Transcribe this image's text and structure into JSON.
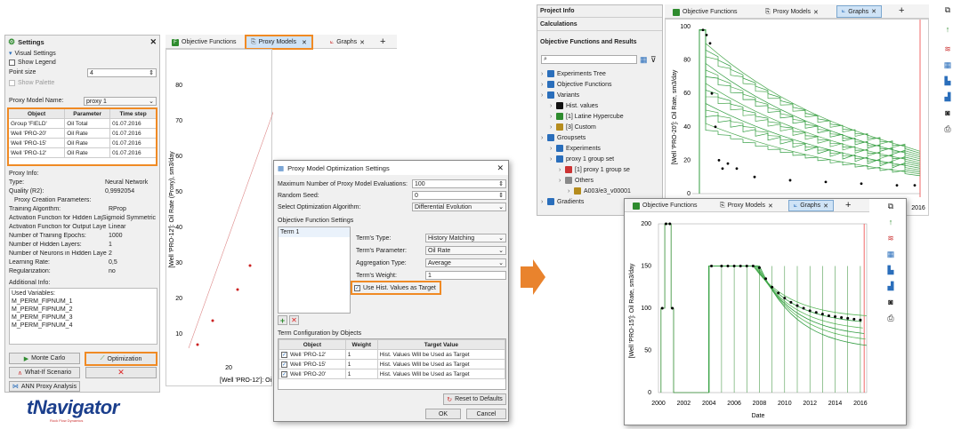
{
  "settings": {
    "title": "Settings",
    "visual_settings": "Visual Settings",
    "show_legend": "Show Legend",
    "point_size_label": "Point size",
    "point_size_value": "4",
    "show_palette": "Show Palette",
    "proxy_model_name_label": "Proxy Model Name:",
    "proxy_model_name_value": "proxy 1",
    "table_headers": [
      "Object",
      "Parameter",
      "Time step"
    ],
    "table_rows": [
      [
        "Group 'FIELD'",
        "Oil Total",
        "01.07.2016"
      ],
      [
        "Well 'PRO-20'",
        "Oil Rate",
        "01.07.2016"
      ],
      [
        "Well 'PRO-15'",
        "Oil Rate",
        "01.07.2016"
      ],
      [
        "Well 'PRO-12'",
        "Oil Rate",
        "01.07.2016"
      ]
    ],
    "proxy_info": "Proxy Info:",
    "type_label": "Type:",
    "type_value": "Neural Network",
    "quality_label": "Quality (R2):",
    "quality_value": "0,9992054",
    "creation_params": "Proxy Creation Parameters:",
    "params": [
      [
        "Training Algorithm:",
        "RProp"
      ],
      [
        "Activation Function for Hidden Laye",
        "Sigmoid Symmetric"
      ],
      [
        "Activation Function for Output Laye",
        "Linear"
      ],
      [
        "Number of Training Epochs:",
        "1000"
      ],
      [
        "Number of Hidden Layers:",
        "1"
      ],
      [
        "Number of Neurons in Hidden Laye",
        "2"
      ],
      [
        "Learning Rate:",
        "0,5"
      ],
      [
        "Regularization:",
        "no"
      ]
    ],
    "additional_info": "Additional Info:",
    "used_variables_label": "Used Variables:",
    "used_variables": [
      "M_PERM_FIPNUM_1",
      "M_PERM_FIPNUM_2",
      "M_PERM_FIPNUM_3",
      "M_PERM_FIPNUM_4"
    ],
    "monte_carlo": "Monte Carlo",
    "optimization": "Optimization",
    "what_if": "What-If Scenario",
    "ann_proxy": "ANN Proxy Analysis"
  },
  "tabs_left": {
    "objective_functions": "Objective Functions",
    "proxy_models": "Proxy Models",
    "graphs": "Graphs",
    "plus": "+"
  },
  "scatter": {
    "y_label": "[Well 'PRO-12']: Oil Rate (Proxy), sm3/day",
    "x_label": "[Well 'PRO-12']: Oi",
    "y_ticks": [
      "80",
      "70",
      "60",
      "50",
      "40",
      "30",
      "20",
      "10"
    ],
    "x_ticks": [
      "20"
    ]
  },
  "dialog": {
    "title": "Proxy Model Optimization Settings",
    "max_evals_label": "Maximum Number of Proxy Model Evaluations:",
    "max_evals_value": "100",
    "random_seed_label": "Random Seed:",
    "random_seed_value": "0",
    "algorithm_label": "Select Optimization Algorithm:",
    "algorithm_value": "Differential Evolution",
    "obj_settings": "Objective Function Settings",
    "term_item": "Term 1",
    "term_type_label": "Term's Type:",
    "term_type_value": "History Matching",
    "term_param_label": "Term's Parameter:",
    "term_param_value": "Oil Rate",
    "agg_label": "Aggregation Type:",
    "agg_value": "Average",
    "weight_label": "Term's Weight:",
    "weight_value": "1",
    "use_hist": "Use Hist. Values as Target",
    "term_config": "Term Configuration by Objects",
    "cfg_headers": [
      "Object",
      "Weight",
      "Target Value"
    ],
    "cfg_rows": [
      [
        "Well 'PRO-12'",
        "1",
        "Hist. Values Will be Used as Target"
      ],
      [
        "Well 'PRO-15'",
        "1",
        "Hist. Values Will be Used as Target"
      ],
      [
        "Well 'PRO-20'",
        "1",
        "Hist. Values Will be Used as Target"
      ]
    ],
    "reset": "Reset to Defaults",
    "ok": "OK",
    "cancel": "Cancel"
  },
  "tree": {
    "project_info": "Project Info",
    "calculations": "Calculations",
    "obj_results": "Objective Functions and Results",
    "items": [
      {
        "label": "Experiments Tree",
        "indent": 1
      },
      {
        "label": "Objective Functions",
        "indent": 1
      },
      {
        "label": "Variants",
        "indent": 1
      },
      {
        "label": "Hist. values",
        "indent": 2
      },
      {
        "label": "[1] Latine Hypercube",
        "indent": 2
      },
      {
        "label": "[3] Custom",
        "indent": 2
      },
      {
        "label": "Groupsets",
        "indent": 1
      },
      {
        "label": "Experiments",
        "indent": 2
      },
      {
        "label": "proxy 1 group set",
        "indent": 2
      },
      {
        "label": "[1] proxy 1 group se",
        "indent": 3
      },
      {
        "label": "Others",
        "indent": 3
      },
      {
        "label": "A003/e3_v00001",
        "indent": 4
      },
      {
        "label": "Gradients",
        "indent": 1
      }
    ]
  },
  "tabs_right": {
    "objective_functions": "Objective Functions",
    "proxy_models": "Proxy Models",
    "graphs": "Graphs",
    "plus": "+"
  },
  "top_chart": {
    "y_label": "[Well 'PRO-20']: Oil Rate, sm3/day",
    "y_ticks": [
      "100",
      "80",
      "60",
      "40",
      "20",
      "0"
    ],
    "x_tick_visible": "2016"
  },
  "bottom_chart": {
    "y_label": "[Well 'PRO-15']: Oil Rate, sm3/day",
    "x_label": "Date",
    "y_ticks": [
      "200",
      "150",
      "100",
      "50",
      "0"
    ],
    "x_ticks": [
      "2000",
      "2002",
      "2004",
      "2006",
      "2008",
      "2010",
      "2012",
      "2014",
      "2016"
    ]
  },
  "logo": {
    "text": "tNavigator",
    "sub": "Rock Flow Dynamics"
  },
  "colors": {
    "accent": "#f08a24",
    "green": "#2e8b2e",
    "tab_active": "#cfe3f6"
  }
}
